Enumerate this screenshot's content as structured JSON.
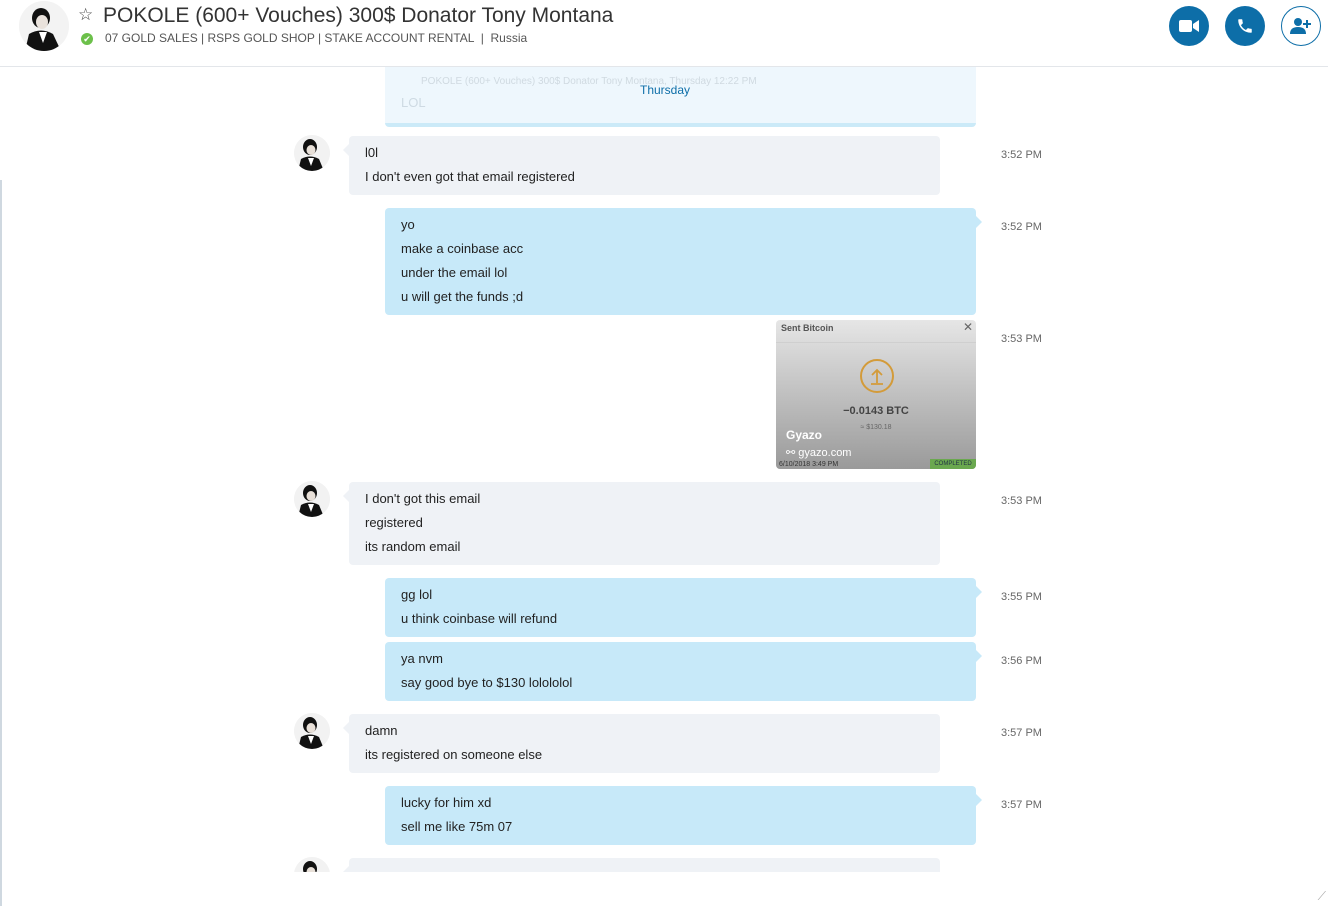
{
  "header": {
    "title": "POKOLE (600+ Vouches) 300$ Donator Tony Montana",
    "mood": "07 GOLD SALES | RSPS GOLD SHOP | STAKE ACCOUNT RENTAL",
    "location": "Russia",
    "status_check": "✔"
  },
  "day_separator": "Thursday",
  "quoted_ghost": {
    "line1": "POKOLE (600+ Vouches) 300$ Donator Tony Montana, Thursday 12:22 PM",
    "line2": "LOL"
  },
  "messages": [
    {
      "direction": "in",
      "lines": [
        "l0l",
        "I don't even got that email registered"
      ],
      "time": "3:52 PM"
    },
    {
      "direction": "out",
      "lines": [
        "yo",
        "make a coinbase acc",
        "under the email lol",
        "u will get the funds ;d"
      ],
      "time": "3:52 PM"
    },
    {
      "direction": "out-image",
      "time": "3:53 PM"
    },
    {
      "direction": "in",
      "lines": [
        "I don't got this email",
        "registered",
        "its random email"
      ],
      "time": "3:53 PM"
    },
    {
      "direction": "out",
      "lines": [
        "gg lol",
        "u think coinbase will refund"
      ],
      "time": "3:55 PM"
    },
    {
      "direction": "out",
      "lines": [
        "ya nvm",
        "say good bye to $130 lolololol"
      ],
      "time": "3:56 PM"
    },
    {
      "direction": "in",
      "lines": [
        "damn",
        "its registered on someone else"
      ],
      "time": "3:57 PM"
    },
    {
      "direction": "out",
      "lines": [
        "lucky for him xd",
        "sell me like 75m 07"
      ],
      "time": "3:57 PM"
    }
  ],
  "link_preview": {
    "header": "Sent Bitcoin",
    "close": "✕",
    "amount": "−0.0143 BTC",
    "usd": "≈ $130.18",
    "site_name": "Gyazo",
    "url": "gyazo.com",
    "date": "6/10/2018 3:49 PM",
    "status": "COMPLETED"
  },
  "partial_message": "",
  "icons": [
    "video-call-icon",
    "audio-call-icon",
    "add-people-icon",
    "star-icon",
    "link-icon",
    "upload-arrow-icon"
  ],
  "colors": {
    "accent": "#0d6ea8",
    "incoming": "#eff2f6",
    "outgoing": "#c7e9f9",
    "status": "#6cc04a"
  }
}
